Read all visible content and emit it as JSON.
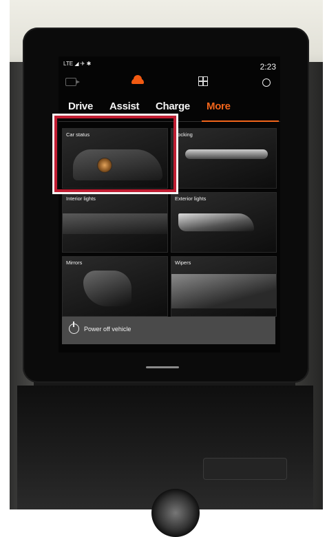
{
  "status_bar": {
    "network": "LTE",
    "time": "2:23"
  },
  "top_icons": [
    "camera-icon",
    "car-icon",
    "grid-icon",
    "profile-icon"
  ],
  "tabs": [
    {
      "label": "Drive",
      "active": false
    },
    {
      "label": "Assist",
      "active": false
    },
    {
      "label": "Charge",
      "active": false
    },
    {
      "label": "More",
      "active": true
    }
  ],
  "tiles": [
    {
      "label": "Car status"
    },
    {
      "label": "Locking"
    },
    {
      "label": "Interior lights"
    },
    {
      "label": "Exterior lights"
    },
    {
      "label": "Mirrors"
    },
    {
      "label": "Wipers"
    }
  ],
  "power": {
    "label": "Power off vehicle"
  },
  "colors": {
    "accent": "#f2651b",
    "highlight": "#c01d32"
  }
}
